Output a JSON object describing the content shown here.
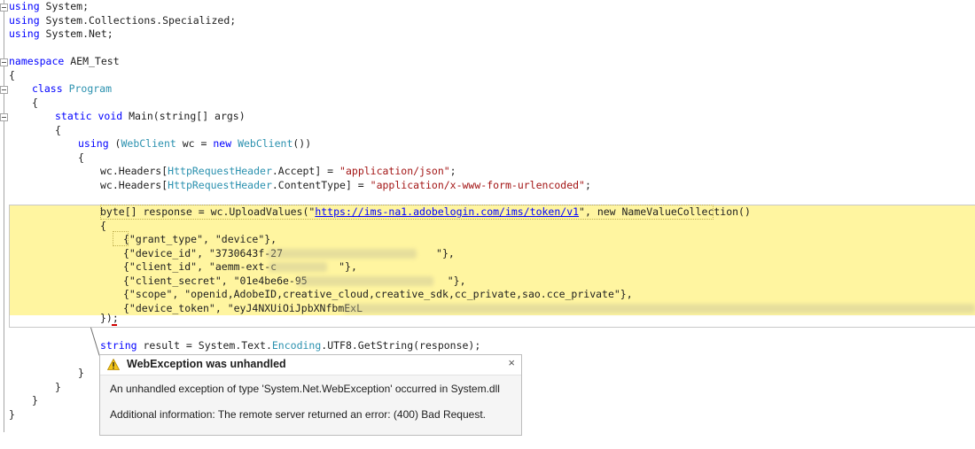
{
  "code": {
    "l1": {
      "kw": "using",
      "rest": " System;"
    },
    "l2": {
      "kw": "using",
      "rest": " System.Collections.Specialized;"
    },
    "l3": {
      "kw": "using",
      "rest": " System.Net;"
    },
    "l5": {
      "kw": "namespace",
      "rest": " AEM_Test"
    },
    "l6": "{",
    "l7": {
      "kw": "class",
      "ty": "Program"
    },
    "l8": "{",
    "l9": {
      "kw1": "static",
      "kw2": "void",
      "rest": " Main(string[] args)"
    },
    "l10": "{",
    "l11": {
      "kw": "using",
      "p1": " (",
      "ty1": "WebClient",
      "p2": " wc = ",
      "kw2": "new",
      "ty2": "WebClient",
      "p3": "())"
    },
    "l12": "{",
    "l13": {
      "p1": "wc.Headers[",
      "ty": "HttpRequestHeader",
      "p2": ".Accept] = ",
      "st": "\"application/json\"",
      "p3": ";"
    },
    "l14": {
      "p1": "wc.Headers[",
      "ty": "HttpRequestHeader",
      "p2": ".ContentType] = ",
      "st": "\"application/x-www-form-urlencoded\"",
      "p3": ";"
    },
    "l16": {
      "p1": "byte[] response = wc.UploadValues(\"",
      "url": "https://ims-na1.adobelogin.com/ims/token/v1",
      "p2": "\", new NameValueCollection()"
    },
    "l17": "{",
    "l18": "{\"grant_type\", \"device\"},",
    "l19": {
      "p1": "{\"device_id\", \"3730643f-27",
      "p2": "\"},"
    },
    "l20": {
      "p1": "{\"client_id\", \"aemm-ext-c",
      "p2": "\"},"
    },
    "l21": {
      "p1": "{\"client_secret\", \"01e4be6e-95",
      "p2": "\"},"
    },
    "l22": "{\"scope\", \"openid,AdobeID,creative_cloud,creative_sdk,cc_private,sao.cce_private\"},",
    "l23": {
      "p1": "{\"device_token\", \"eyJ4NXUiOiJpbXNfbmExL"
    },
    "l24": "});",
    "l26": {
      "p1": "string",
      "p2": " result = System.Text.",
      "ty": "Encoding",
      "p3": ".UTF8.GetString(response);"
    },
    "l27": "}",
    "l28": "}",
    "l29": "}",
    "l30": "}"
  },
  "popup": {
    "title": "WebException was unhandled",
    "close": "×",
    "message1": "An unhandled exception of type 'System.Net.WebException' occurred in System.dll",
    "message2": "Additional information: The remote server returned an error: (400) Bad Request."
  },
  "icons": {
    "warning": "warning-icon",
    "close": "close-icon"
  },
  "colors": {
    "keyword": "#0000ff",
    "type": "#2b91af",
    "highlight": "#fff5a0"
  }
}
